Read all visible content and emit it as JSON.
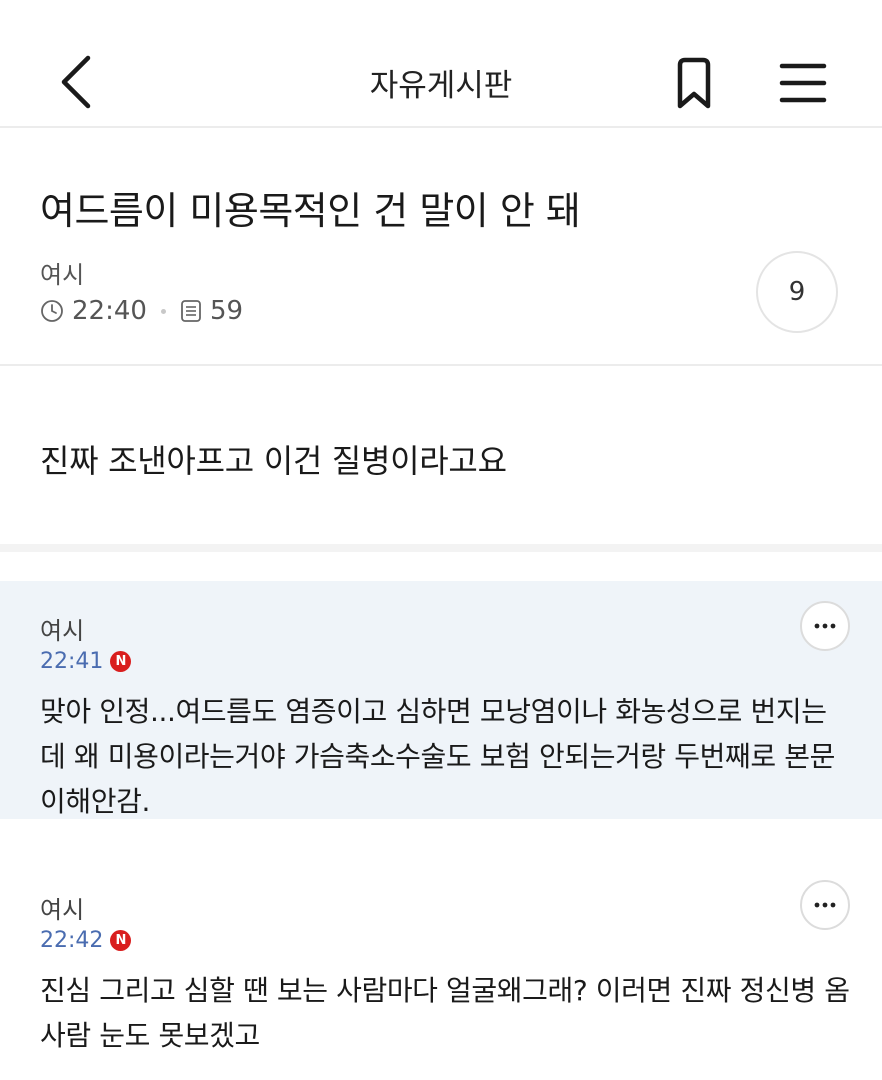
{
  "header": {
    "title": "자유게시판",
    "back_icon": "chevron-left-icon",
    "bookmark_icon": "bookmark-icon",
    "menu_icon": "hamburger-menu-icon"
  },
  "post": {
    "title": "여드름이 미용목적인 건 말이 안 돼",
    "author": "여시",
    "time": "22:40",
    "views": "59",
    "comment_count": "9",
    "body": "진짜 조낸아프고 이건 질병이라고요"
  },
  "comments": [
    {
      "author": "여시",
      "time": "22:41",
      "badge": "N",
      "text": "맞아 인정...여드름도 염증이고 심하면 모낭염이나 화농성으로 번지는데 왜 미용이라는거야 가슴축소수술도 보험 안되는거랑 두번째로 본문 이해안감."
    },
    {
      "author": "여시",
      "time": "22:42",
      "badge": "N",
      "text": "진심 그리고 심할 땐 보는 사람마다 얼굴왜그래? 이러면 진짜 정신병 옴 사람 눈도 못보겠고"
    }
  ],
  "colors": {
    "highlight_comment_bg": "#eff4f9",
    "time_text": "#4a6cb0",
    "new_badge": "#d91e1e"
  }
}
